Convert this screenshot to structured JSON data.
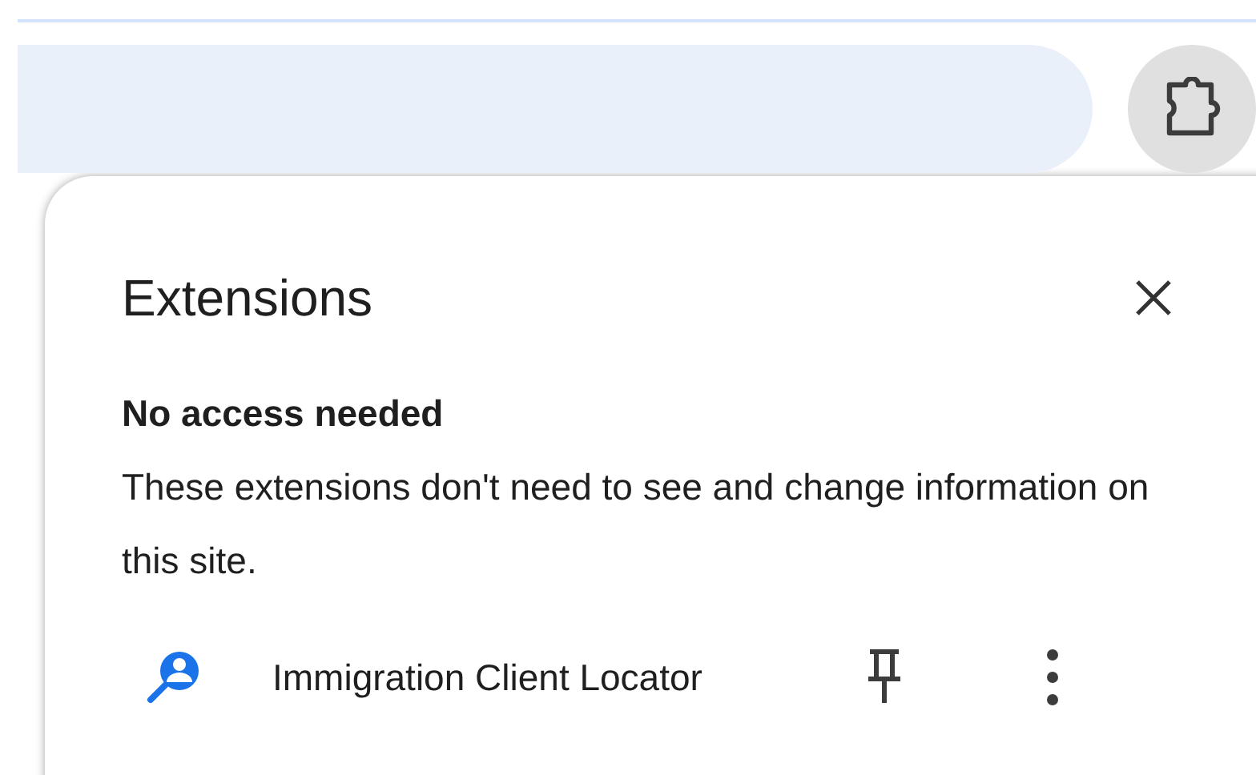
{
  "popup": {
    "title": "Extensions",
    "section_heading": "No access needed",
    "section_text": "These extensions don't need to see and change information on this site.",
    "extensions": [
      {
        "name": "Immigration Client Locator",
        "pinned": false
      }
    ]
  }
}
